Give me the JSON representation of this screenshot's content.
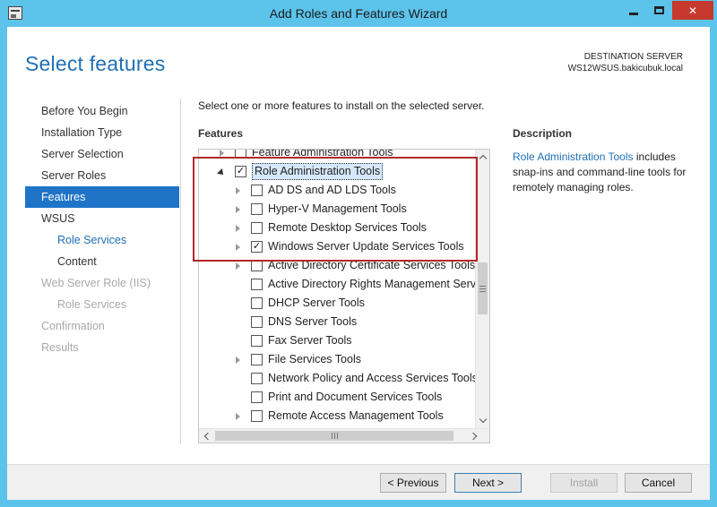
{
  "window": {
    "title": "Add Roles and Features Wizard"
  },
  "header": {
    "page_title": "Select features",
    "destination_label": "DESTINATION SERVER",
    "destination_server": "WS12WSUS.bakicubuk.local"
  },
  "nav": {
    "items": [
      {
        "label": "Before You Begin",
        "state": "normal"
      },
      {
        "label": "Installation Type",
        "state": "normal"
      },
      {
        "label": "Server Selection",
        "state": "normal"
      },
      {
        "label": "Server Roles",
        "state": "normal"
      },
      {
        "label": "Features",
        "state": "active"
      },
      {
        "label": "WSUS",
        "state": "normal"
      },
      {
        "label": "Role Services",
        "state": "link"
      },
      {
        "label": "Content",
        "state": "normal"
      },
      {
        "label": "Web Server Role (IIS)",
        "state": "disabled"
      },
      {
        "label": "Role Services",
        "state": "disabled"
      },
      {
        "label": "Confirmation",
        "state": "disabled"
      },
      {
        "label": "Results",
        "state": "disabled"
      }
    ]
  },
  "main": {
    "instruction": "Select one or more features to install on the selected server.",
    "features_label": "Features",
    "features": [
      {
        "label": "Feature Administration Tools",
        "level": 1,
        "expander": "right",
        "checked": false
      },
      {
        "label": "Role Administration Tools",
        "level": 1,
        "expander": "down",
        "checked": true,
        "selected": true
      },
      {
        "label": "AD DS and AD LDS Tools",
        "level": 2,
        "expander": "right",
        "checked": false
      },
      {
        "label": "Hyper-V Management Tools",
        "level": 2,
        "expander": "right",
        "checked": false
      },
      {
        "label": "Remote Desktop Services Tools",
        "level": 2,
        "expander": "right",
        "checked": false
      },
      {
        "label": "Windows Server Update Services Tools",
        "level": 2,
        "expander": "right",
        "checked": true
      },
      {
        "label": "Active Directory Certificate Services Tools",
        "level": 2,
        "expander": "right",
        "checked": false
      },
      {
        "label": "Active Directory Rights Management Servic",
        "level": 2,
        "expander": "none",
        "checked": false
      },
      {
        "label": "DHCP Server Tools",
        "level": 2,
        "expander": "none",
        "checked": false
      },
      {
        "label": "DNS Server Tools",
        "level": 2,
        "expander": "none",
        "checked": false
      },
      {
        "label": "Fax Server Tools",
        "level": 2,
        "expander": "none",
        "checked": false
      },
      {
        "label": "File Services Tools",
        "level": 2,
        "expander": "right",
        "checked": false
      },
      {
        "label": "Network Policy and Access Services Tools",
        "level": 2,
        "expander": "none",
        "checked": false
      },
      {
        "label": "Print and Document Services Tools",
        "level": 2,
        "expander": "none",
        "checked": false
      },
      {
        "label": "Remote Access Management Tools",
        "level": 2,
        "expander": "right",
        "checked": false
      }
    ]
  },
  "description": {
    "label": "Description",
    "link_text": "Role Administration Tools",
    "body": " includes snap-ins and command-line tools for remotely managing roles."
  },
  "footer": {
    "previous": "< Previous",
    "next": "Next >",
    "install": "Install",
    "cancel": "Cancel"
  },
  "colors": {
    "frame": "#5cc3eb",
    "accent": "#1f74c8",
    "title_blue": "#1f6fb5",
    "highlight_box": "#b3262a"
  }
}
